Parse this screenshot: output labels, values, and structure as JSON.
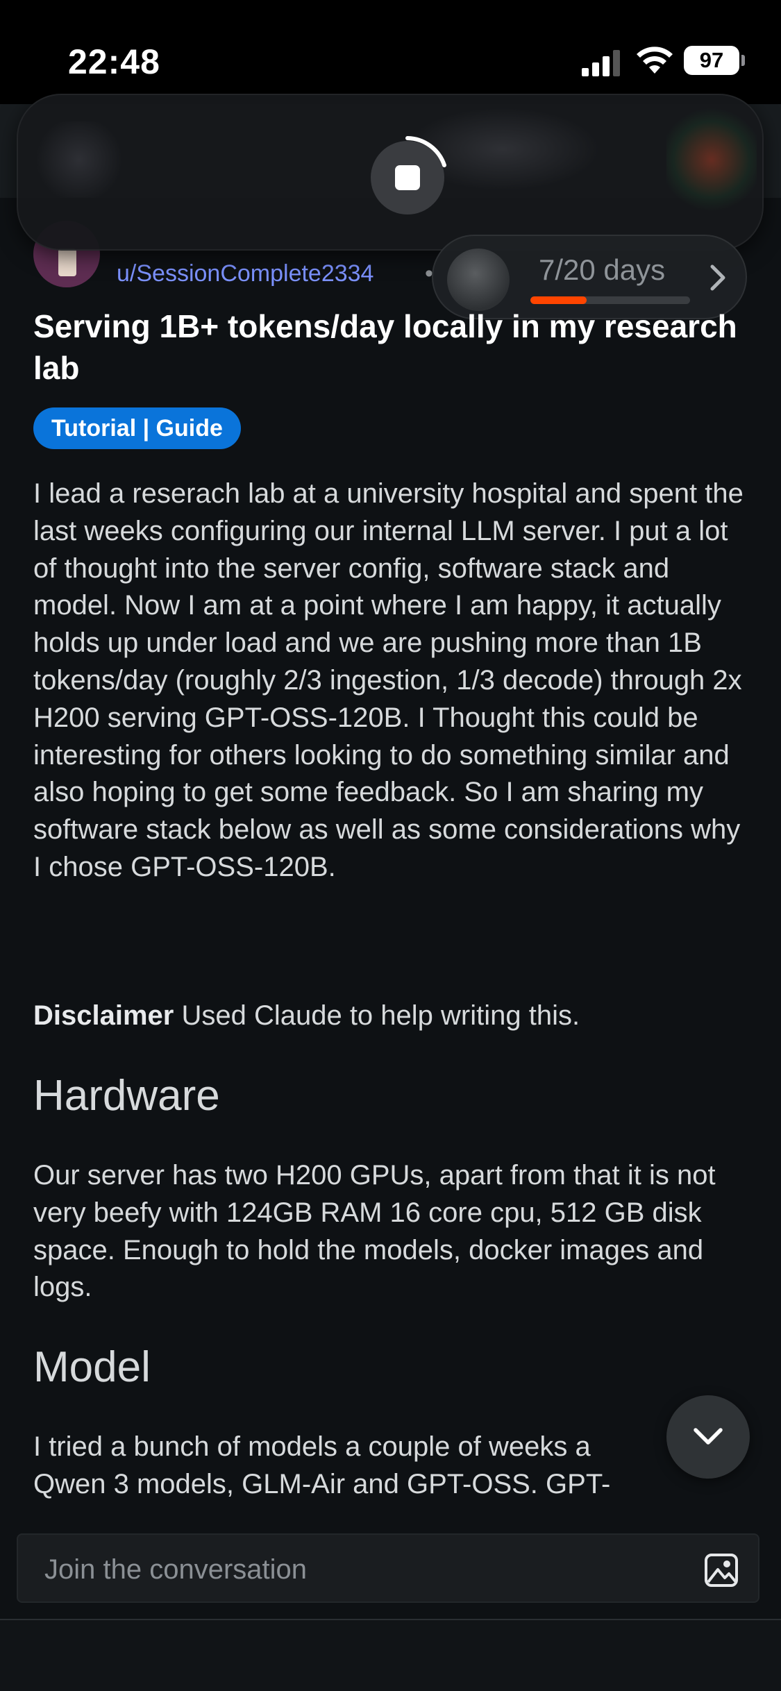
{
  "status_bar": {
    "time": "22:48",
    "battery": "97",
    "icons": [
      "cellular-signal-icon",
      "wifi-icon",
      "battery-icon"
    ]
  },
  "player": {
    "icon": "stop-icon",
    "state": "loading"
  },
  "author": {
    "username": "u/SessionComplete2334",
    "separator": "•"
  },
  "streak": {
    "label": "7/20 days",
    "progress": 0.35,
    "icon": "chevron-right-icon"
  },
  "post": {
    "title": "Serving 1B+ tokens/day locally in my research lab",
    "flair": "Tutorial | Guide",
    "flair_color": "#0a74da",
    "paragraph_1": "I lead a reserach lab at a university hospital and spent the last weeks configuring our internal LLM server. I put a lot of thought into the server config, software stack and model. Now I am at a point where I am happy, it actually holds up under load and we are pushing more than 1B tokens/day (roughly 2/3 ingestion, 1/3 decode) through 2x H200 serving GPT-OSS-120B. I Thought this could be interesting for others looking to do something similar and also hoping to get some feedback. So I am sharing my software stack below as well as some considerations why I chose GPT-OSS-120B.",
    "disclaimer_label": "Disclaimer",
    "disclaimer_text": " Used Claude to help writing this.",
    "heading_hardware": "Hardware",
    "paragraph_hardware": "Our server has two H200 GPUs, apart from that it is not very beefy with 124GB RAM 16 core cpu, 512 GB disk space. Enough to hold the models, docker images and logs.",
    "heading_model": "Model",
    "paragraph_model_line1": "I tried a bunch of models a couple of weeks a",
    "paragraph_model_line2": "Qwen 3 models, GLM-Air and GPT-OSS. GPT-"
  },
  "comment_bar": {
    "placeholder": "Join the conversation",
    "icon": "image-icon"
  },
  "colors": {
    "background": "#0e1114",
    "username": "#7c92ff",
    "streak_fill": "#ff4500"
  }
}
